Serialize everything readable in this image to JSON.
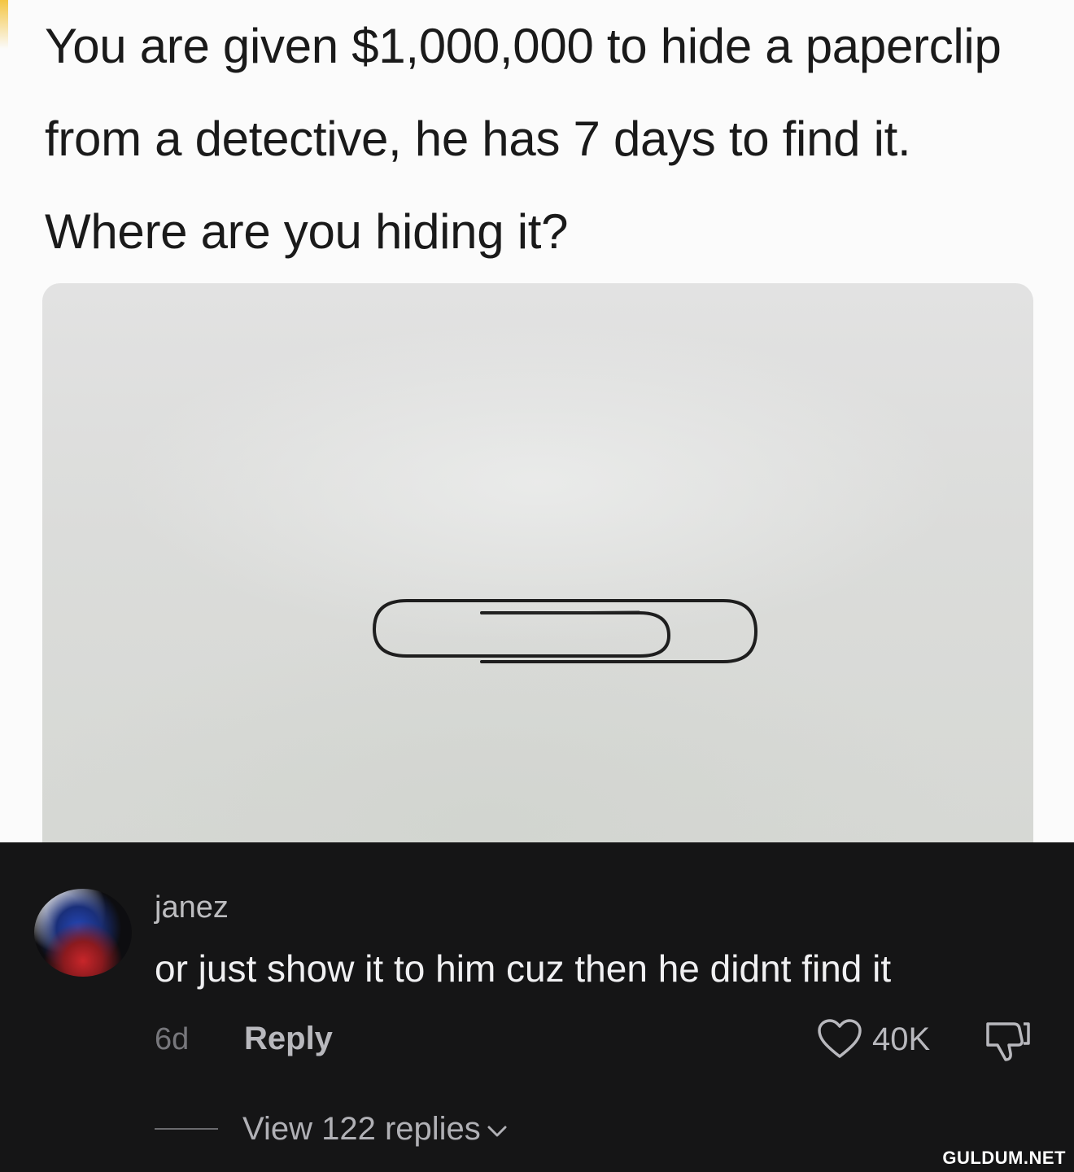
{
  "post": {
    "question": "You are given $1,000,000 to hide a paperclip from a detective, he has 7 days to find it. Where are you hiding it?"
  },
  "comment": {
    "username": "janez",
    "text": "or just show it to him cuz then he didnt find it",
    "age": "6d",
    "reply_label": "Reply",
    "like_count": "40K",
    "view_replies_label": "View 122 replies"
  },
  "icons": {
    "like": "heart-outline-icon",
    "dislike": "thumbs-down-outline-icon",
    "expand": "chevron-down-icon"
  },
  "watermark": "GULDUM.NET"
}
